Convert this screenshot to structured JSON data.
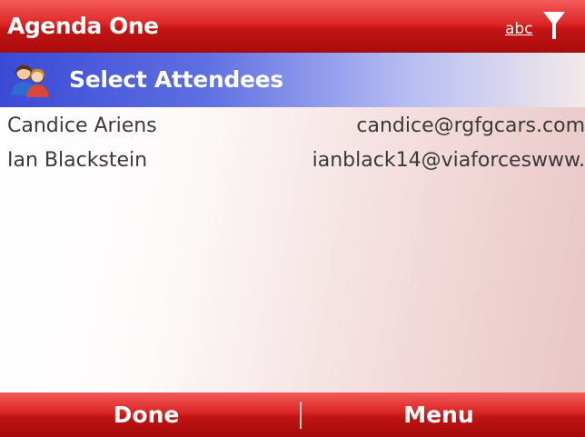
{
  "app": {
    "title": "Agenda One",
    "input_mode": "abc",
    "signal_icon": "antenna-signal-icon"
  },
  "screen": {
    "title": "Select Attendees",
    "icon": "people-icon"
  },
  "attendees": [
    {
      "name": "Candice Ariens",
      "email": "candice@rgfgcars.com"
    },
    {
      "name": "Ian Blackstein",
      "email": "ianblack14@viaforceswww."
    }
  ],
  "softkeys": {
    "left": "Done",
    "right": "Menu"
  },
  "colors": {
    "title_bar": "#d42020",
    "header_gradient_start": "#3b4ad6",
    "softkey_bar": "#d42020",
    "text": "#3a3a3a"
  }
}
